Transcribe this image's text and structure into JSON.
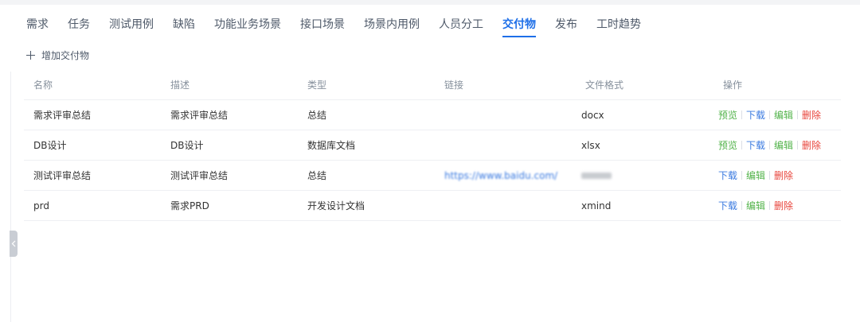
{
  "tabs": [
    {
      "label": "需求"
    },
    {
      "label": "任务"
    },
    {
      "label": "测试用例"
    },
    {
      "label": "缺陷"
    },
    {
      "label": "功能业务场景"
    },
    {
      "label": "接口场景"
    },
    {
      "label": "场景内用例"
    },
    {
      "label": "人员分工"
    },
    {
      "label": "交付物",
      "active": true
    },
    {
      "label": "发布"
    },
    {
      "label": "工时趋势"
    }
  ],
  "toolbar": {
    "add_label": "增加交付物"
  },
  "table": {
    "columns": [
      "名称",
      "描述",
      "类型",
      "链接",
      "文件格式",
      "操作"
    ],
    "rows": [
      {
        "name": "需求评审总结",
        "desc": "需求评审总结",
        "type": "总结",
        "link": "",
        "format": "docx",
        "actions": {
          "preview": "预览",
          "download": "下载",
          "edit": "编辑",
          "delete": "删除"
        }
      },
      {
        "name": "DB设计",
        "desc": "DB设计",
        "type": "数据库文档",
        "link": "",
        "format": "xlsx",
        "actions": {
          "preview": "预览",
          "download": "下载",
          "edit": "编辑",
          "delete": "删除"
        }
      },
      {
        "name": "测试评审总结",
        "desc": "测试评审总结",
        "type": "总结",
        "link": "https://www.baidu.com/",
        "format": "",
        "actions": {
          "download": "下载",
          "edit": "编辑",
          "delete": "删除"
        }
      },
      {
        "name": "prd",
        "desc": "需求PRD",
        "type": "开发设计文档",
        "link": "",
        "format": "xmind",
        "actions": {
          "download": "下载",
          "edit": "编辑",
          "delete": "删除"
        }
      }
    ]
  },
  "colors": {
    "accent": "#1e6fe8",
    "preview": "#52b34a",
    "download": "#3a7ae0",
    "edit": "#52b34a",
    "delete": "#e8453c"
  }
}
